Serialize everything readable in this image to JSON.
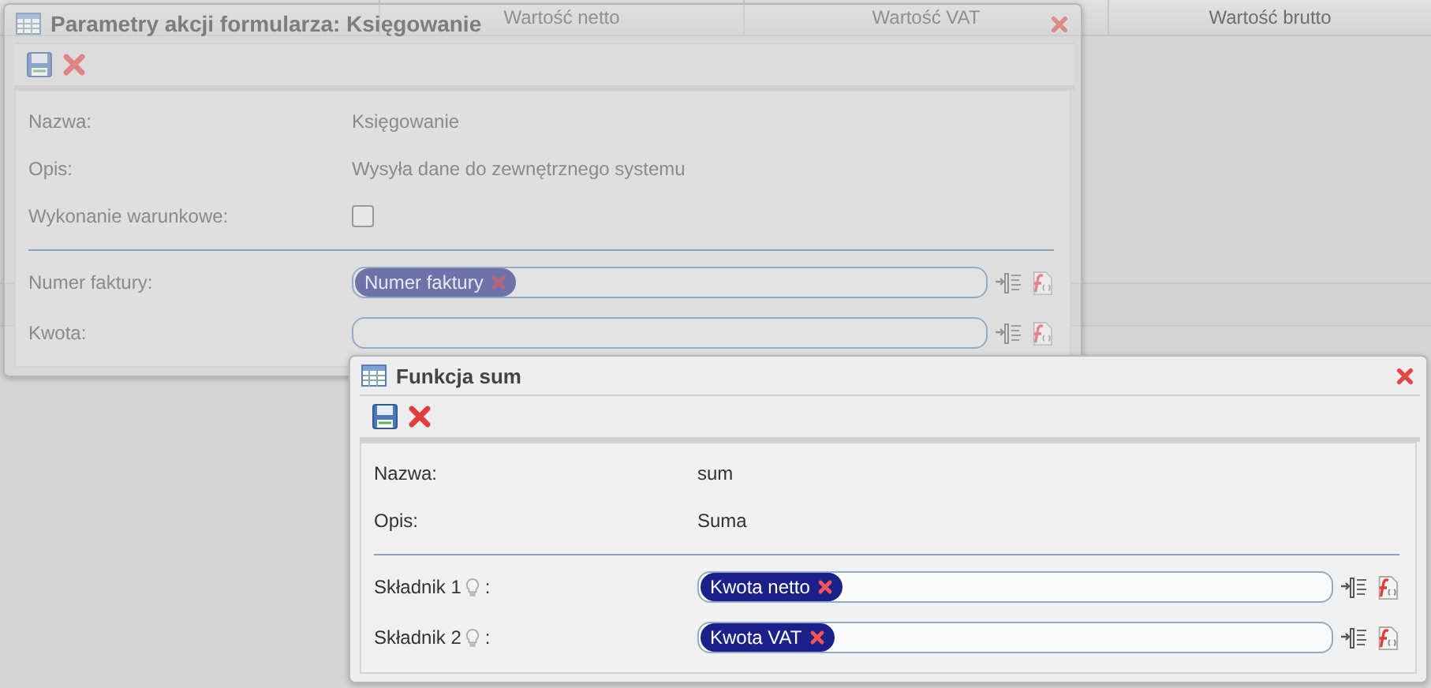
{
  "background_table": {
    "columns": [
      "Wartość netto",
      "Wartość VAT",
      "Wartość brutto"
    ]
  },
  "dialogs": [
    {
      "title": "Parametry akcji formularza: Księgowanie",
      "active": false,
      "info": [
        {
          "kind": "text",
          "label": "Nazwa:",
          "value": "Księgowanie"
        },
        {
          "kind": "text",
          "label": "Opis:",
          "value": "Wysyła dane do zewnętrznego systemu"
        },
        {
          "kind": "checkbox",
          "label": "Wykonanie warunkowe:",
          "checked": false
        }
      ],
      "params": [
        {
          "label": "Numer faktury:",
          "hint": false,
          "tokens": [
            "Numer faktury"
          ]
        },
        {
          "label": "Kwota:",
          "hint": false
        }
      ]
    },
    {
      "title": "Funkcja sum",
      "active": true,
      "info": [
        {
          "kind": "text",
          "label": "Nazwa:",
          "value": "sum"
        },
        {
          "kind": "text",
          "label": "Opis:",
          "value": "Suma"
        }
      ],
      "params": [
        {
          "label": "Składnik 1",
          "hint": true,
          "after_hint": ":",
          "tokens": [
            "Kwota netto"
          ]
        },
        {
          "label": "Składnik 2",
          "hint": true,
          "after_hint": ":",
          "tokens": [
            "Kwota VAT"
          ]
        }
      ]
    }
  ]
}
